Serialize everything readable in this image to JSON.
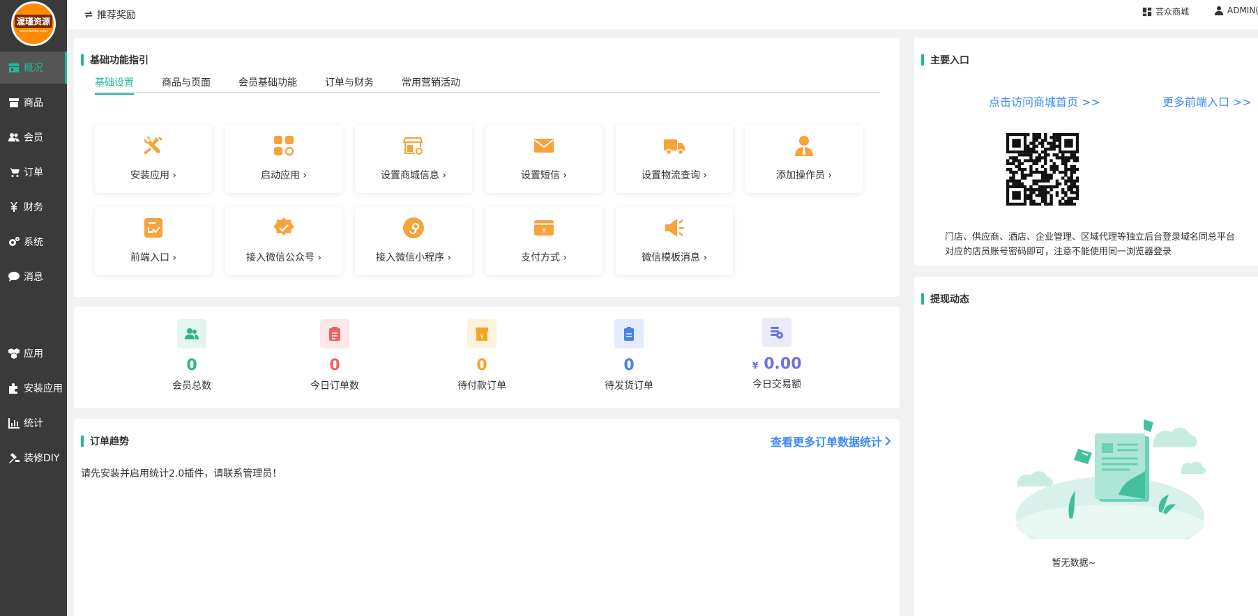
{
  "brand": {
    "logo_text": "渥瑾资源",
    "logo_sub": "www.bzzbc.com"
  },
  "colors": {
    "accent": "#20b89a",
    "sidebar_bg": "#3a3a3a",
    "icon_orange": "#f5a33b",
    "link_blue": "#3d8af7"
  },
  "sidebar": {
    "items": [
      {
        "label": "概况",
        "icon": "store-icon"
      },
      {
        "label": "商品",
        "icon": "box-icon"
      },
      {
        "label": "会员",
        "icon": "users-icon"
      },
      {
        "label": "订单",
        "icon": "cart-icon"
      },
      {
        "label": "财务",
        "icon": "yen-icon"
      },
      {
        "label": "系统",
        "icon": "gears-icon"
      },
      {
        "label": "消息",
        "icon": "chat-icon"
      },
      {
        "label": "应用",
        "icon": "cubes-icon"
      },
      {
        "label": "安装应用",
        "icon": "puzzle-icon"
      },
      {
        "label": "统计",
        "icon": "bar-chart-icon"
      },
      {
        "label": "装修DIY",
        "icon": "gavel-icon"
      }
    ]
  },
  "topbar": {
    "left_label": "推荐奖励",
    "shop_label": "芸众商城",
    "user_label": "ADMIN("
  },
  "guide": {
    "title": "基础功能指引",
    "tabs": [
      "基础设置",
      "商品与页面",
      "会员基础功能",
      "订单与财务",
      "常用营销活动"
    ],
    "tiles": [
      {
        "label": "安装应用",
        "icon": "tools-icon"
      },
      {
        "label": "启动应用",
        "icon": "apps-icon"
      },
      {
        "label": "设置商城信息",
        "icon": "shop-settings-icon"
      },
      {
        "label": "设置短信",
        "icon": "envelope-icon"
      },
      {
        "label": "设置物流查询",
        "icon": "truck-icon"
      },
      {
        "label": "添加操作员",
        "icon": "person-icon"
      },
      {
        "label": "前端入口",
        "icon": "entry-icon"
      },
      {
        "label": "接入微信公众号",
        "icon": "verified-badge-icon"
      },
      {
        "label": "接入微信小程序",
        "icon": "mini-program-icon"
      },
      {
        "label": "支付方式",
        "icon": "wallet-icon"
      },
      {
        "label": "微信模板消息",
        "icon": "megaphone-icon"
      }
    ],
    "chevron": "›"
  },
  "stats": [
    {
      "value": "0",
      "label": "会员总数",
      "color": "#2db58a",
      "bg": "#e3f6ee",
      "icon": "members-icon"
    },
    {
      "value": "0",
      "label": "今日订单数",
      "color": "#f06060",
      "bg": "#fde8e8",
      "icon": "clipboard-icon"
    },
    {
      "value": "0",
      "label": "待付款订单",
      "color": "#f2a628",
      "bg": "#fdf3dc",
      "icon": "pending-pay-icon"
    },
    {
      "value": "0",
      "label": "待发货订单",
      "color": "#4a7ff0",
      "bg": "#e3ecfd",
      "icon": "shipping-list-icon"
    },
    {
      "value": "0.00",
      "prefix": "¥",
      "label": "今日交易额",
      "color": "#6c72e0",
      "bg": "#ebeaf9",
      "icon": "coins-icon"
    }
  ],
  "trend": {
    "title": "订单趋势",
    "more_link": "查看更多订单数据统计",
    "notice": "请先安装并启用统计2.0插件，请联系管理员！"
  },
  "entry": {
    "title": "主要入口",
    "visit_link": "点击访问商城首页 >>",
    "more_link": "更多前端入口 >>",
    "description_line1": "门店、供应商、酒店、企业管理、区域代理等独立后台登录域名同总平台",
    "description_line2": "对应的店员账号密码即可，注意不能使用同一浏览器登录"
  },
  "withdraw": {
    "title": "提现动态",
    "empty_text": "暂无数据~"
  }
}
